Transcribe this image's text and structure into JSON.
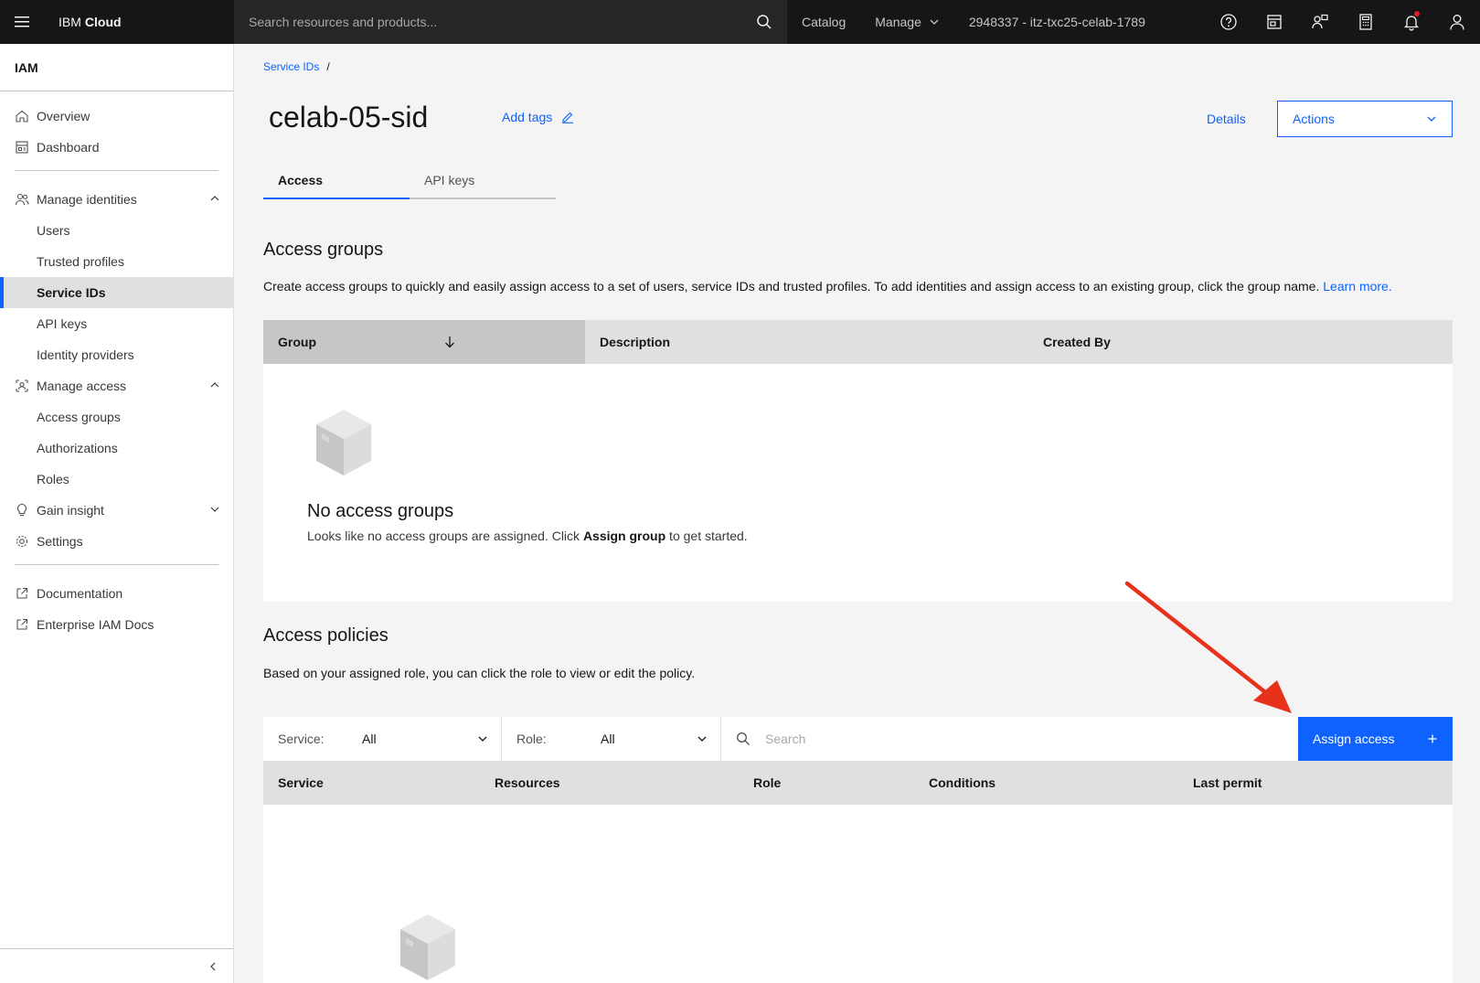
{
  "header": {
    "brand_prefix": "IBM",
    "brand_name": "Cloud",
    "search_placeholder": "Search resources and products...",
    "nav": {
      "catalog": "Catalog",
      "manage": "Manage"
    },
    "account": "2948337 - itz-txc25-celab-1789",
    "icons": [
      "help-icon",
      "cost-estimator-icon",
      "support-icon",
      "calculator-icon",
      "notification-icon",
      "user-avatar-icon"
    ]
  },
  "sidebar": {
    "title": "IAM",
    "items": {
      "overview": "Overview",
      "dashboard": "Dashboard",
      "manage_identities": "Manage identities",
      "users": "Users",
      "trusted_profiles": "Trusted profiles",
      "service_ids": "Service IDs",
      "api_keys": "API keys",
      "identity_providers": "Identity providers",
      "manage_access": "Manage access",
      "access_groups": "Access groups",
      "authorizations": "Authorizations",
      "roles": "Roles",
      "gain_insight": "Gain insight",
      "settings": "Settings",
      "documentation": "Documentation",
      "enterprise_docs": "Enterprise IAM Docs"
    },
    "active": "Service IDs"
  },
  "breadcrumb": {
    "parent": "Service IDs",
    "separator": "/"
  },
  "page": {
    "title": "celab-05-sid",
    "add_tags": "Add tags",
    "details": "Details",
    "actions": "Actions"
  },
  "tabs": [
    {
      "label": "Access",
      "active": true
    },
    {
      "label": "API keys",
      "active": false
    }
  ],
  "access_groups": {
    "title": "Access groups",
    "description": "Create access groups to quickly and easily assign access to a set of users, service IDs and trusted profiles. To add identities and assign access to an existing group, click the group name.",
    "learn_more": "Learn more.",
    "columns": [
      "Group",
      "Description",
      "Created By"
    ],
    "empty_title": "No access groups",
    "empty_desc_pre": "Looks like no access groups are assigned. Click ",
    "empty_desc_bold": "Assign group",
    "empty_desc_post": " to get started."
  },
  "access_policies": {
    "title": "Access policies",
    "description": "Based on your assigned role, you can click the role to view or edit the policy.",
    "filters": {
      "service_label": "Service:",
      "service_value": "All",
      "role_label": "Role:",
      "role_value": "All"
    },
    "search_placeholder": "Search",
    "assign_button": "Assign access",
    "columns": [
      "Service",
      "Resources",
      "Role",
      "Conditions",
      "Last permit"
    ]
  },
  "colors": {
    "accent": "#0f62fe",
    "header_bg": "#161616",
    "annotation_arrow": "#e8311a"
  }
}
